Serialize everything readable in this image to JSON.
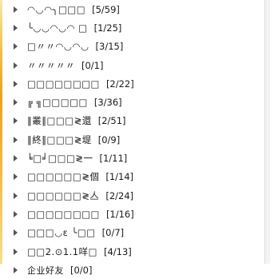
{
  "groups": [
    {
      "name": "◠◡◠╮□□□",
      "count": "[5/59]"
    },
    {
      "name": "╰◡◡◠◡◠ □",
      "count": "[1/25]"
    },
    {
      "name": "□〃〃◠◡◠◡",
      "count": "[3/15]"
    },
    {
      "name": "〃〃〃〃〃",
      "count": "[0/1]"
    },
    {
      "name": "□□□□□□□□",
      "count": "[2/22]"
    },
    {
      "name": "╔ ╗□□□□□",
      "count": "[3/36]"
    },
    {
      "name": "‖叢‖□□□≷還",
      "count": "[2/51]"
    },
    {
      "name": "‖終‖□□□≷堤",
      "count": "[0/9]"
    },
    {
      "name": "╘□╛□□□≷一",
      "count": "[1/11]"
    },
    {
      "name": "□□□□□□≷個",
      "count": "[1/14]"
    },
    {
      "name": "□□□□□□≷亼",
      "count": "[2/24]"
    },
    {
      "name": "□□□□□□□□",
      "count": "[1/16]"
    },
    {
      "name": "□□□◡ɛ ╰□□",
      "count": "[0/7]"
    },
    {
      "name": "□□2.⊙1.1咩□",
      "count": "[4/13]"
    },
    {
      "name": "企业好友",
      "count": "[0/0]"
    }
  ]
}
